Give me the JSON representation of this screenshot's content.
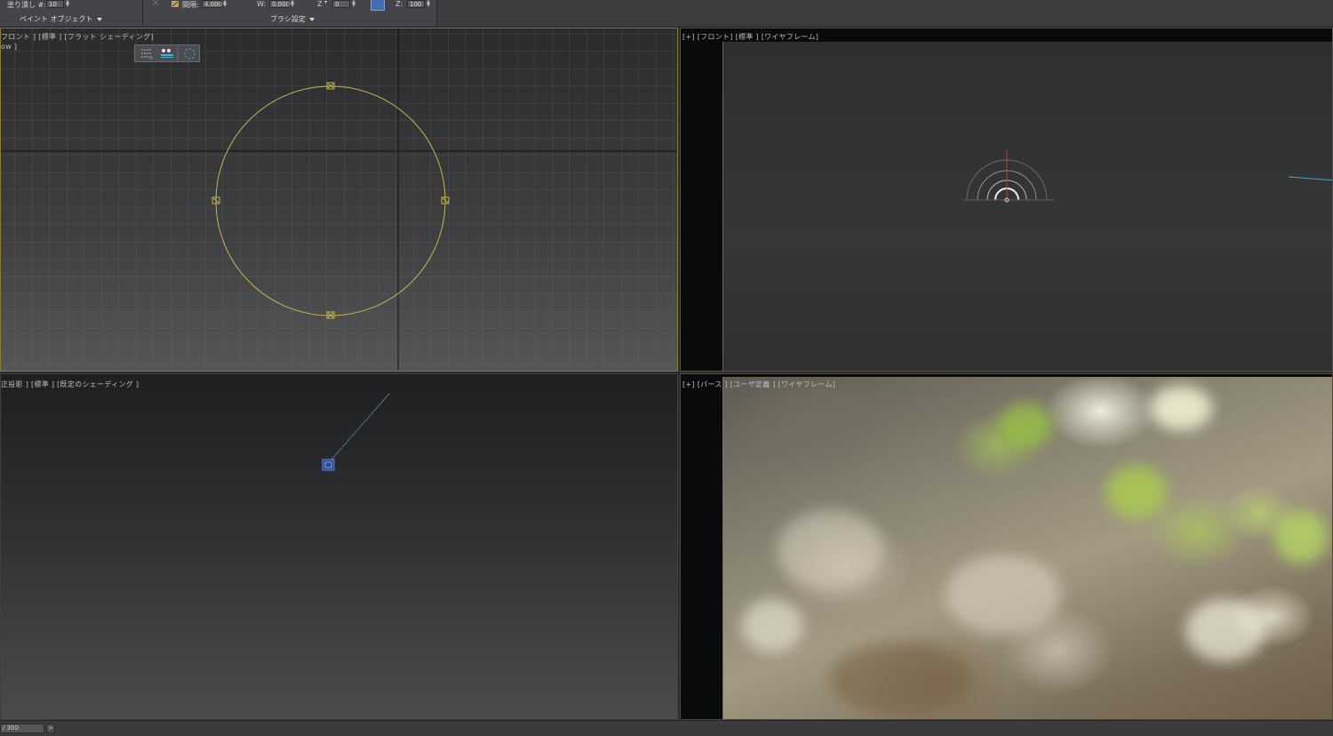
{
  "ribbon": {
    "fill_label": "塗り潰し #:",
    "fill_value": "10",
    "paint_objects": "ペイント オブジェクト",
    "spacing_label": "間隔:",
    "spacing_value": "4.000",
    "w_label": "W:",
    "w_value": "0.000",
    "z_axis_label": "Z",
    "z_axis_value": "0",
    "z_label": "Z:",
    "z_value": "100",
    "brush_settings": "ブラシ設定"
  },
  "viewports": {
    "top_left": {
      "label": "フロント ] [標準 ] [フラット シェーディング]",
      "sublabel": "ow ]"
    },
    "top_right": {
      "label": "[+] [フロント] [標準 ] [ワイヤフレーム]"
    },
    "bottom_left": {
      "label": "正投影 ] [標準 ] [既定のシェーディング ]"
    },
    "bottom_right": {
      "label": "[+] [パース ] [ユーザ定義 ] [ワイヤフレーム]"
    }
  },
  "statusbar": {
    "frame": "/ 300",
    "next": ">"
  },
  "colors": {
    "selection_yellow": "#c9b54a",
    "light_blue": "#4a9fd0",
    "ribbon_blue": "#3f6fb0",
    "gizmo_red": "#d23a3a"
  },
  "icons": [
    "up-down-spinner-icon",
    "dropdown-arrow-icon",
    "brush-icon",
    "lock-icon",
    "point-grid-icon",
    "dots-row-icon",
    "dotted-circle-icon",
    "circle-gizmo-icon",
    "light-icon"
  ]
}
